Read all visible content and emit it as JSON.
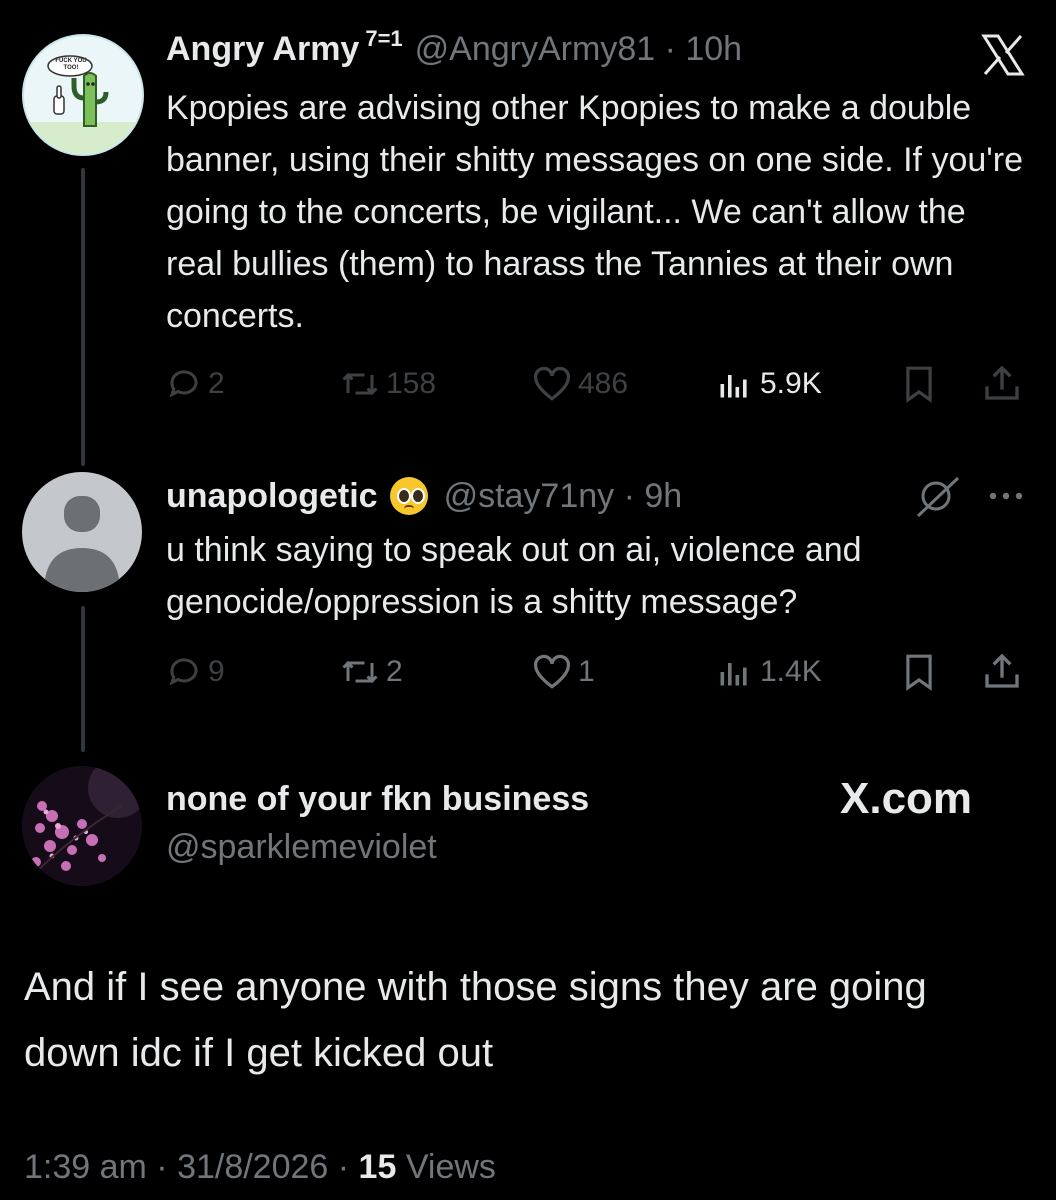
{
  "tweet1": {
    "display_name": "Angry Army",
    "superscript": "7=1",
    "handle_time": "@AngryArmy81 · 10h",
    "avatar_sign": "FUCK YOU TOO!",
    "text": "Kpopies are advising other Kpopies to make a double banner, using their shitty messages on one side. If you're going to the concerts, be vigilant... We can't allow the real bullies (them) to harass the Tannies at their own concerts.",
    "replies": "2",
    "reposts": "158",
    "likes": "486",
    "views": "5.9K"
  },
  "tweet2": {
    "display_name": "unapologetic",
    "emoji": "🥺",
    "handle_time": "@stay71ny · 9h",
    "text": "u think saying to speak out on ai, violence and genocide/oppression is a shitty message?",
    "replies": "9",
    "reposts": "2",
    "likes": "1",
    "views": "1.4K"
  },
  "tweet3": {
    "display_name": "none of your fkn business",
    "handle": "@sparklemeviolet",
    "text": "And if I see anyone with those signs they are going down idc if I get kicked out",
    "timestamp": "1:39 am · 31/8/2026 · ",
    "views_count": "15",
    "views_label": " Views"
  },
  "branding": {
    "x_logo": "X",
    "xcom": "X.com"
  },
  "colors": {
    "background": "#000000",
    "text": "#e7e9ea",
    "secondary": "#71767b",
    "thread_line": "#333639"
  }
}
